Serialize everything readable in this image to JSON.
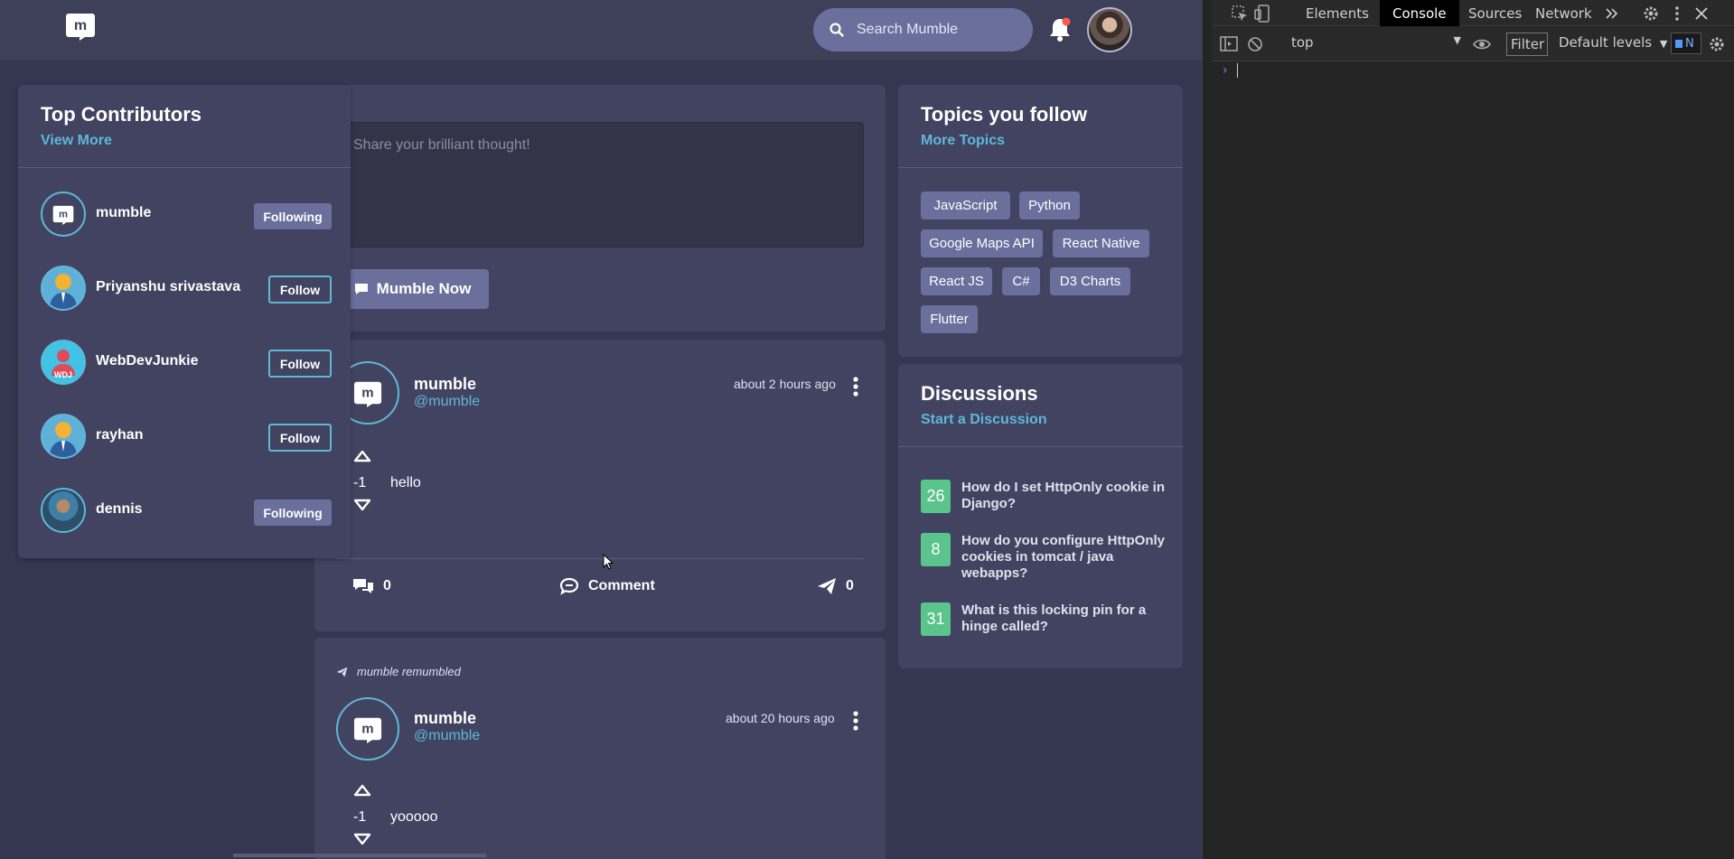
{
  "app": {
    "search_placeholder": "Search Mumble",
    "notification_dot_color": "#ff5a4e"
  },
  "compose": {
    "placeholder": "Share your brilliant thought!",
    "submit_label": "Mumble Now"
  },
  "contributors": {
    "title": "Top Contributors",
    "link": "View More",
    "items": [
      {
        "name": "mumble",
        "action": "Following"
      },
      {
        "name": "Priyanshu srivastava",
        "action": "Follow"
      },
      {
        "name": "WebDevJunkie",
        "action": "Follow"
      },
      {
        "name": "rayhan",
        "action": "Follow"
      },
      {
        "name": "dennis",
        "action": "Following"
      }
    ],
    "webdev_avatar_text": "WDJ"
  },
  "posts": [
    {
      "name": "mumble",
      "handle": "@mumble",
      "time": "about 2 hours ago",
      "votes": "-1",
      "text": "hello",
      "comments_count": "0",
      "comment_label": "Comment",
      "shares_count": "0"
    },
    {
      "remumbled_label": "mumble remumbled",
      "name": "mumble",
      "handle": "@mumble",
      "time": "about 20 hours ago",
      "votes": "-1",
      "text": "yooooo"
    }
  ],
  "topics": {
    "title": "Topics you follow",
    "link": "More Topics",
    "tags": [
      "JavaScript",
      "Python",
      "Google Maps API",
      "React Native",
      "React JS",
      "C#",
      "D3 Charts",
      "Flutter"
    ]
  },
  "discussions": {
    "title": "Discussions",
    "link": "Start a Discussion",
    "items": [
      {
        "count": "26",
        "text": "How do I set HttpOnly cookie in Django?"
      },
      {
        "count": "8",
        "text": "How do you configure HttpOnly cookies in tomcat / java webapps?"
      },
      {
        "count": "31",
        "text": "What is this locking pin for a hinge called?"
      }
    ]
  },
  "devtools": {
    "tabs": [
      "Elements",
      "Console",
      "Sources",
      "Network"
    ],
    "active_tab": "Console",
    "context": "top",
    "filter_label": "Filter",
    "levels_label": "Default levels",
    "issues_label": "N",
    "prompt": "›"
  },
  "colors": {
    "background": "#353750",
    "card": "#414361",
    "accent": "#5fb8d6",
    "button": "#6a6f9c",
    "discussion_count": "#5ac48c"
  }
}
